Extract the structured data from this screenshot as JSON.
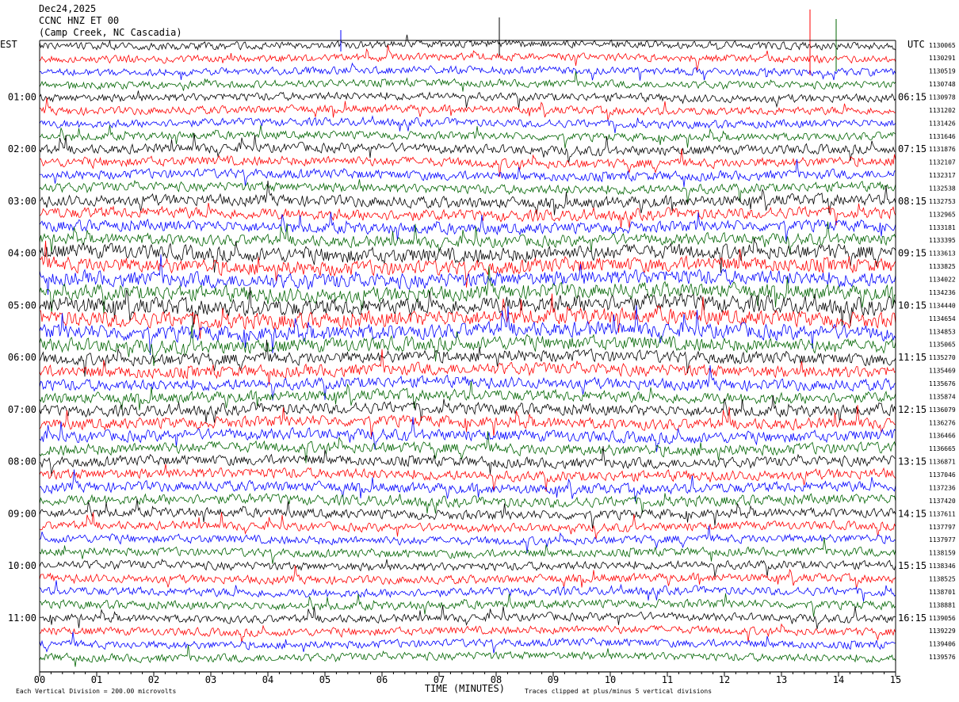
{
  "header": {
    "date": "Dec24,2025",
    "station": "CCNC HNZ ET 00",
    "location": "(Camp Creek, NC Cascadia)"
  },
  "chart_data": {
    "type": "line",
    "title": "CCNC HNZ ET 00",
    "left_axis_label": "EST",
    "right_axis_label": "UTC",
    "xlabel": "TIME (MINUTES)",
    "xlim": [
      0,
      15
    ],
    "x_ticks": [
      "00",
      "01",
      "02",
      "03",
      "04",
      "05",
      "06",
      "07",
      "08",
      "09",
      "10",
      "11",
      "12",
      "13",
      "14",
      "15"
    ],
    "est_hour_labels": [
      "01:00",
      "02:00",
      "03:00",
      "04:00",
      "05:00",
      "06:00",
      "07:00",
      "08:00",
      "09:00",
      "10:00",
      "11:00"
    ],
    "utc_hour_labels": [
      "06:15",
      "07:15",
      "08:15",
      "09:15",
      "10:15",
      "11:15",
      "12:15",
      "13:15",
      "14:15",
      "15:15",
      "16:15"
    ],
    "row_counts": [
      "1130065",
      "1130291",
      "1130519",
      "1130748",
      "1130978",
      "1131202",
      "1131426",
      "1131646",
      "1131876",
      "1132107",
      "1132317",
      "1132538",
      "1132753",
      "1132965",
      "1133181",
      "1133395",
      "1133613",
      "1133825",
      "1134022",
      "1134236",
      "1134440",
      "1134654",
      "1134853",
      "1135065",
      "1135270",
      "1135469",
      "1135676",
      "1135874",
      "1136079",
      "1136276",
      "1136466",
      "1136665",
      "1136871",
      "1137046",
      "1137236",
      "1137420",
      "1137611",
      "1137797",
      "1137977",
      "1138159",
      "1138346",
      "1138525",
      "1138701",
      "1138881",
      "1139056",
      "1139229",
      "1139406",
      "1139576"
    ],
    "series_colors": [
      "#000000",
      "#ff0000",
      "#0000ff",
      "#006400"
    ],
    "row_amplitude_profile": [
      0.8,
      0.8,
      0.8,
      0.8,
      0.85,
      0.85,
      0.85,
      0.85,
      1.0,
      1.0,
      1.0,
      1.0,
      1.2,
      1.2,
      1.2,
      1.2,
      1.6,
      1.6,
      1.6,
      1.6,
      1.8,
      1.7,
      1.6,
      1.5,
      1.3,
      1.3,
      1.2,
      1.2,
      1.2,
      1.2,
      1.2,
      1.2,
      1.1,
      1.1,
      1.1,
      1.1,
      1.0,
      0.9,
      0.9,
      0.9,
      0.9,
      0.9,
      0.9,
      0.9,
      0.85,
      0.85,
      0.85,
      0.85
    ],
    "footer_left": "Each Vertical Division =  200.00 microvolts",
    "footer_right": "Traces clipped at plus/minus 5 vertical divisions"
  }
}
